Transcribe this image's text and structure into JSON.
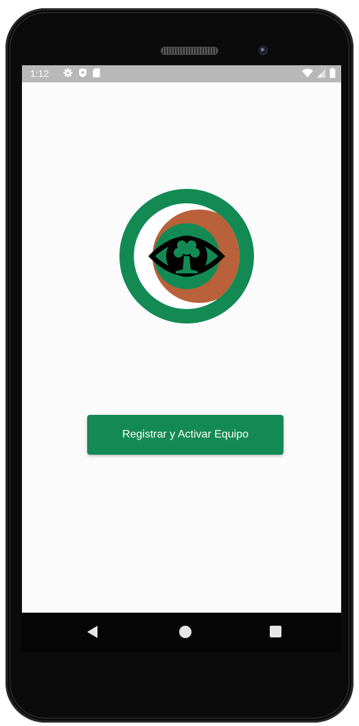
{
  "status_bar": {
    "time": "1:12",
    "left_icons": [
      "settings-icon",
      "shield-icon",
      "sd-card-icon"
    ],
    "right_icons": [
      "wifi-icon",
      "signal-icon",
      "battery-icon"
    ]
  },
  "logo": {
    "icon": "eye-tree-logo-icon",
    "colors": {
      "outer_ring": "#138a54",
      "crescent": "#b8613a",
      "inner_disc": "#138a54",
      "eye": "#000000"
    }
  },
  "main": {
    "register_button_label": "Registrar y Activar Equipo",
    "accent_color": "#138a54"
  },
  "nav_bar": {
    "items": [
      "back-icon",
      "home-icon",
      "recents-icon"
    ]
  }
}
